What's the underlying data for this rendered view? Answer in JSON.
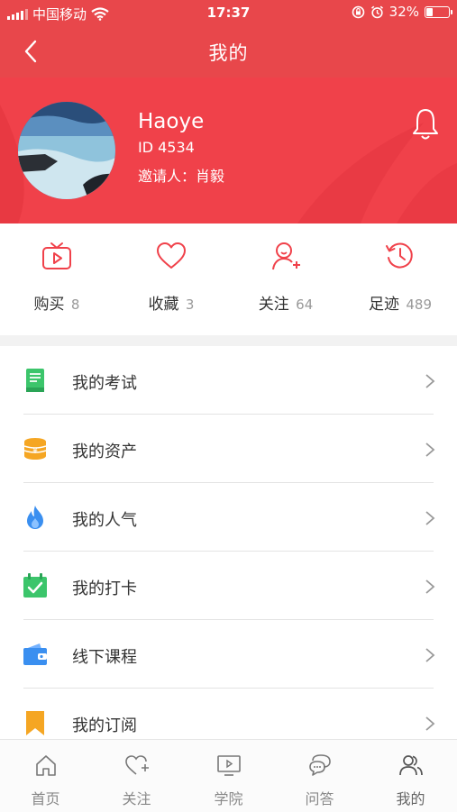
{
  "status_bar": {
    "carrier": "中国移动",
    "time": "17:37",
    "battery": "32%",
    "battery_level": 0.32
  },
  "nav": {
    "title": "我的"
  },
  "profile": {
    "name": "Haoye",
    "id": "ID 4534",
    "inviter": "邀请人：肖毅"
  },
  "stats": [
    {
      "label": "购买",
      "count": "8",
      "icon": "tv-play-icon"
    },
    {
      "label": "收藏",
      "count": "3",
      "icon": "heart-icon"
    },
    {
      "label": "关注",
      "count": "64",
      "icon": "user-add-icon"
    },
    {
      "label": "足迹",
      "count": "489",
      "icon": "history-icon"
    }
  ],
  "menu": [
    {
      "label": "我的考试",
      "icon": "book-icon",
      "color": "#3cc56b"
    },
    {
      "label": "我的资产",
      "icon": "coins-icon",
      "color": "#f5a623"
    },
    {
      "label": "我的人气",
      "icon": "flame-icon",
      "color": "#3a8ff0"
    },
    {
      "label": "我的打卡",
      "icon": "calendar-check-icon",
      "color": "#3cc56b"
    },
    {
      "label": "线下课程",
      "icon": "wallet-icon",
      "color": "#3a8ff0"
    },
    {
      "label": "我的订阅",
      "icon": "bookmark-icon",
      "color": "#f5a623"
    }
  ],
  "tabs": [
    {
      "label": "首页",
      "icon": "home-icon"
    },
    {
      "label": "关注",
      "icon": "heart-plus-icon"
    },
    {
      "label": "学院",
      "icon": "monitor-play-icon"
    },
    {
      "label": "问答",
      "icon": "chat-bubbles-icon"
    },
    {
      "label": "我的",
      "icon": "users-icon",
      "active": true
    }
  ],
  "colors": {
    "brand_red": "#e8474b",
    "header_red": "#f0414a"
  }
}
